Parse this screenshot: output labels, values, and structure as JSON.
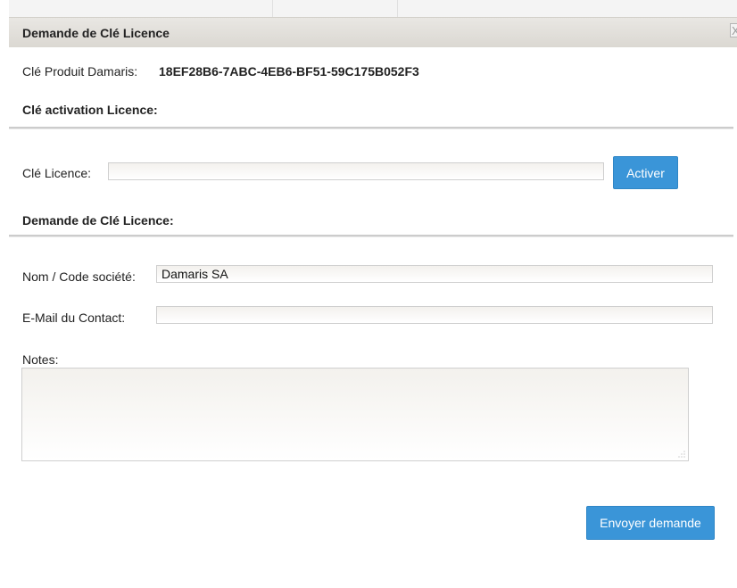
{
  "dialog": {
    "title": "Demande de Clé Licence",
    "close_glyph": "X"
  },
  "product": {
    "label": "Clé Produit Damaris:",
    "key": "18EF28B6-7ABC-4EB6-BF51-59C175B052F3"
  },
  "activation": {
    "heading": "Clé activation Licence:",
    "licence_label": "Clé Licence:",
    "licence_value": "",
    "activate_label": "Activer"
  },
  "request": {
    "heading": "Demande de Clé Licence:",
    "company_label": "Nom / Code société:",
    "company_value": "Damaris SA",
    "email_label": "E-Mail du Contact:",
    "email_value": "",
    "notes_label": "Notes:",
    "notes_value": "",
    "send_label": "Envoyer demande"
  },
  "colors": {
    "button": "#3a95d8",
    "titlebar": "#e2dfda",
    "rule": "#cccccc"
  }
}
